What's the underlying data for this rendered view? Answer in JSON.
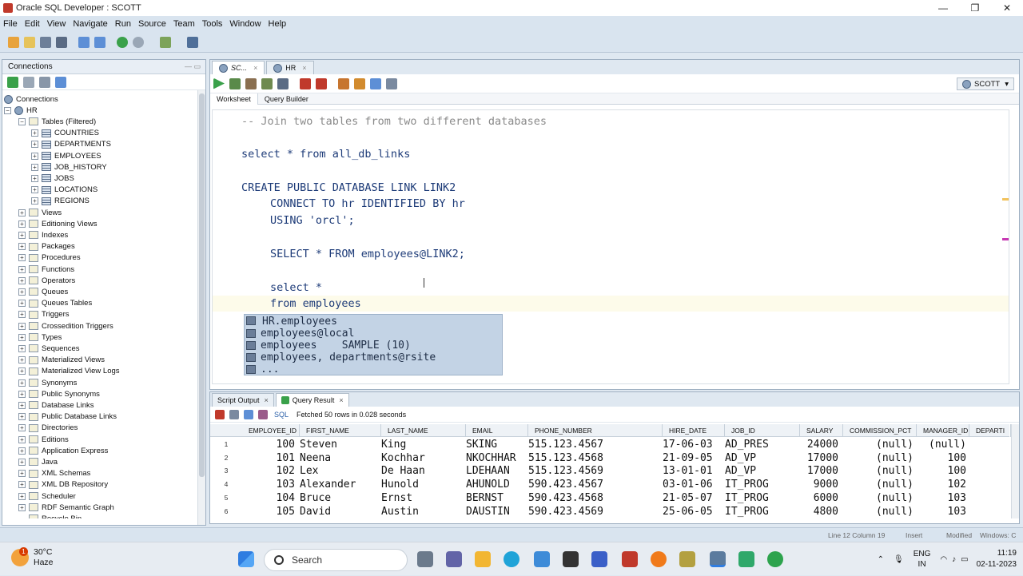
{
  "window": {
    "title": "Oracle SQL Developer : SCOTT",
    "controls": [
      "—",
      "❐",
      "✕"
    ]
  },
  "menu": [
    "File",
    "Edit",
    "View",
    "Navigate",
    "Run",
    "Source",
    "Team",
    "Tools",
    "Window",
    "Help"
  ],
  "connections_panel": {
    "title": "Connections",
    "tree": [
      {
        "label": "Connections",
        "level": 0,
        "icon": "db",
        "exp": ""
      },
      {
        "label": "HR",
        "level": 1,
        "icon": "db",
        "exp": "−"
      },
      {
        "label": "Tables (Filtered)",
        "level": 2,
        "icon": "folder",
        "exp": "−"
      },
      {
        "label": "COUNTRIES",
        "level": 3,
        "icon": "table",
        "exp": "+"
      },
      {
        "label": "DEPARTMENTS",
        "level": 3,
        "icon": "table",
        "exp": "+"
      },
      {
        "label": "EMPLOYEES",
        "level": 3,
        "icon": "table",
        "exp": "+"
      },
      {
        "label": "JOB_HISTORY",
        "level": 3,
        "icon": "table",
        "exp": "+"
      },
      {
        "label": "JOBS",
        "level": 3,
        "icon": "table",
        "exp": "+"
      },
      {
        "label": "LOCATIONS",
        "level": 3,
        "icon": "table",
        "exp": "+"
      },
      {
        "label": "REGIONS",
        "level": 3,
        "icon": "table",
        "exp": "+"
      },
      {
        "label": "Views",
        "level": 2,
        "icon": "folder",
        "exp": "+"
      },
      {
        "label": "Editioning Views",
        "level": 2,
        "icon": "folder",
        "exp": "+"
      },
      {
        "label": "Indexes",
        "level": 2,
        "icon": "folder",
        "exp": "+"
      },
      {
        "label": "Packages",
        "level": 2,
        "icon": "folder",
        "exp": "+"
      },
      {
        "label": "Procedures",
        "level": 2,
        "icon": "folder",
        "exp": "+"
      },
      {
        "label": "Functions",
        "level": 2,
        "icon": "folder",
        "exp": "+"
      },
      {
        "label": "Operators",
        "level": 2,
        "icon": "folder",
        "exp": "+"
      },
      {
        "label": "Queues",
        "level": 2,
        "icon": "folder",
        "exp": "+"
      },
      {
        "label": "Queues Tables",
        "level": 2,
        "icon": "folder",
        "exp": "+"
      },
      {
        "label": "Triggers",
        "level": 2,
        "icon": "folder",
        "exp": "+"
      },
      {
        "label": "Crossedition Triggers",
        "level": 2,
        "icon": "folder",
        "exp": "+"
      },
      {
        "label": "Types",
        "level": 2,
        "icon": "folder",
        "exp": "+"
      },
      {
        "label": "Sequences",
        "level": 2,
        "icon": "folder",
        "exp": "+"
      },
      {
        "label": "Materialized Views",
        "level": 2,
        "icon": "folder",
        "exp": "+"
      },
      {
        "label": "Materialized View Logs",
        "level": 2,
        "icon": "folder",
        "exp": "+"
      },
      {
        "label": "Synonyms",
        "level": 2,
        "icon": "folder",
        "exp": "+"
      },
      {
        "label": "Public Synonyms",
        "level": 2,
        "icon": "folder",
        "exp": "+"
      },
      {
        "label": "Database Links",
        "level": 2,
        "icon": "folder",
        "exp": "+"
      },
      {
        "label": "Public Database Links",
        "level": 2,
        "icon": "folder",
        "exp": "+"
      },
      {
        "label": "Directories",
        "level": 2,
        "icon": "folder",
        "exp": "+"
      },
      {
        "label": "Editions",
        "level": 2,
        "icon": "folder",
        "exp": "+"
      },
      {
        "label": "Application Express",
        "level": 2,
        "icon": "folder",
        "exp": "+"
      },
      {
        "label": "Java",
        "level": 2,
        "icon": "folder",
        "exp": "+"
      },
      {
        "label": "XML Schemas",
        "level": 2,
        "icon": "folder",
        "exp": "+"
      },
      {
        "label": "XML DB Repository",
        "level": 2,
        "icon": "folder",
        "exp": "+"
      },
      {
        "label": "Scheduler",
        "level": 2,
        "icon": "folder",
        "exp": "+"
      },
      {
        "label": "RDF Semantic Graph",
        "level": 2,
        "icon": "folder",
        "exp": "+"
      },
      {
        "label": "Recycle Bin",
        "level": 2,
        "icon": "folder",
        "exp": ""
      }
    ]
  },
  "editor": {
    "tabs": [
      {
        "label": "SC...",
        "active": true
      },
      {
        "label": "HR",
        "active": false
      }
    ],
    "connection": "SCOTT",
    "subtabs": [
      "Worksheet",
      "Query Builder"
    ],
    "lines": [
      {
        "text": "-- Join two tables from two different databases",
        "type": "comment",
        "indent": 0
      },
      {
        "text": "select * from all_db_links",
        "type": "code",
        "indent": 0
      },
      {
        "text": "CREATE PUBLIC DATABASE LINK LINK2",
        "type": "code",
        "indent": 0
      },
      {
        "text": "CONNECT TO hr IDENTIFIED BY hr",
        "type": "code",
        "indent": 1
      },
      {
        "text": "USING 'orcl';",
        "type": "code",
        "indent": 1
      },
      {
        "text": "SELECT * FROM employees@LINK2;",
        "type": "code",
        "indent": 1
      },
      {
        "text": "select *",
        "type": "code",
        "indent": 1
      },
      {
        "text": "from employees",
        "type": "code",
        "indent": 1
      }
    ],
    "autocomplete": [
      "HR.employees",
      "employees@local",
      "employees    SAMPLE (10)",
      "employees, departments@rsite",
      "..."
    ]
  },
  "results": {
    "tabs": [
      {
        "label": "Script Output",
        "active": false
      },
      {
        "label": "Query Result",
        "active": true
      }
    ],
    "sql_label": "SQL",
    "status": "Fetched 50 rows in 0.028 seconds",
    "columns": [
      "EMPLOYEE_ID",
      "FIRST_NAME",
      "LAST_NAME",
      "EMAIL",
      "PHONE_NUMBER",
      "HIRE_DATE",
      "JOB_ID",
      "SALARY",
      "COMMISSION_PCT",
      "MANAGER_ID",
      "DEPARTI"
    ],
    "rows": [
      [
        "1",
        "100",
        "Steven",
        "King",
        "SKING",
        "515.123.4567",
        "17-06-03",
        "AD_PRES",
        "24000",
        "(null)",
        "(null)"
      ],
      [
        "2",
        "101",
        "Neena",
        "Kochhar",
        "NKOCHHAR",
        "515.123.4568",
        "21-09-05",
        "AD_VP",
        "17000",
        "(null)",
        "100"
      ],
      [
        "3",
        "102",
        "Lex",
        "De Haan",
        "LDEHAAN",
        "515.123.4569",
        "13-01-01",
        "AD_VP",
        "17000",
        "(null)",
        "100"
      ],
      [
        "4",
        "103",
        "Alexander",
        "Hunold",
        "AHUNOLD",
        "590.423.4567",
        "03-01-06",
        "IT_PROG",
        "9000",
        "(null)",
        "102"
      ],
      [
        "5",
        "104",
        "Bruce",
        "Ernst",
        "BERNST",
        "590.423.4568",
        "21-05-07",
        "IT_PROG",
        "6000",
        "(null)",
        "103"
      ],
      [
        "6",
        "105",
        "David",
        "Austin",
        "DAUSTIN",
        "590.423.4569",
        "25-06-05",
        "IT_PROG",
        "4800",
        "(null)",
        "103"
      ]
    ]
  },
  "statusbar": {
    "position": "Line 12 Column 19",
    "mode": "Insert",
    "modified": "Modified",
    "os": "Windows: C"
  },
  "taskbar": {
    "weather_temp": "30°C",
    "weather_desc": "Haze",
    "weather_badge": "1",
    "search_label": "Search",
    "lang1": "ENG",
    "lang2": "IN",
    "time": "11:19",
    "date": "02-11-2023"
  }
}
